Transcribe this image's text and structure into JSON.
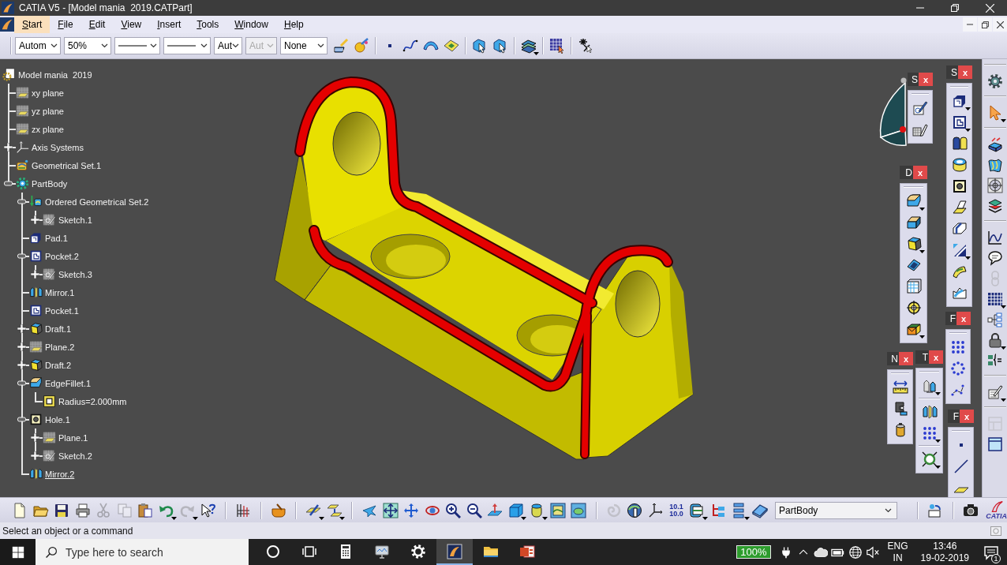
{
  "window": {
    "title": "CATIA V5 - [Model mania  2019.CATPart]"
  },
  "menu": [
    {
      "label": "Start",
      "selected": true
    },
    {
      "label": "File",
      "selected": false
    },
    {
      "label": "Edit",
      "selected": false
    },
    {
      "label": "View",
      "selected": false
    },
    {
      "label": "Insert",
      "selected": false
    },
    {
      "label": "Tools",
      "selected": false
    },
    {
      "label": "Window",
      "selected": false
    },
    {
      "label": "Help",
      "selected": false
    }
  ],
  "toolbar_selects": [
    {
      "kind": "text",
      "value": "Autom",
      "disabled": false
    },
    {
      "kind": "text",
      "value": "50%",
      "disabled": false
    },
    {
      "kind": "line",
      "disabled": false
    },
    {
      "kind": "line",
      "disabled": false
    },
    {
      "kind": "text",
      "value": "Aut",
      "disabled": false
    },
    {
      "kind": "text",
      "value": "Aut",
      "disabled": true
    },
    {
      "kind": "text",
      "value": "None",
      "disabled": false
    }
  ],
  "tree": {
    "label": "Model mania  2019",
    "kind": "part",
    "expandable": false,
    "in_work": false,
    "children": [
      {
        "label": "xy plane",
        "kind": "plane",
        "expandable": false,
        "in_work": false
      },
      {
        "label": "yz plane",
        "kind": "plane",
        "expandable": false,
        "in_work": false
      },
      {
        "label": "zx plane",
        "kind": "plane",
        "expandable": false,
        "in_work": false
      },
      {
        "label": "Axis Systems",
        "kind": "axis",
        "expandable": true,
        "expanded": false,
        "in_work": false
      },
      {
        "label": "Geometrical Set.1",
        "kind": "geoset",
        "expandable": false,
        "in_work": false
      },
      {
        "label": "PartBody",
        "kind": "body",
        "expandable": true,
        "expanded": true,
        "in_work": false,
        "children": [
          {
            "label": "Ordered Geometrical Set.2",
            "kind": "orderedset",
            "expandable": true,
            "expanded": true,
            "in_work": false,
            "children": [
              {
                "label": "Sketch.1",
                "kind": "sketch",
                "expandable": true,
                "expanded": false,
                "in_work": false
              }
            ]
          },
          {
            "label": "Pad.1",
            "kind": "pad",
            "expandable": false,
            "in_work": false
          },
          {
            "label": "Pocket.2",
            "kind": "pocket",
            "expandable": true,
            "expanded": true,
            "in_work": false,
            "children": [
              {
                "label": "Sketch.3",
                "kind": "sketch",
                "expandable": true,
                "expanded": false,
                "in_work": false
              }
            ]
          },
          {
            "label": "Mirror.1",
            "kind": "mirror",
            "expandable": false,
            "in_work": false
          },
          {
            "label": "Pocket.1",
            "kind": "pocket",
            "expandable": false,
            "in_work": false
          },
          {
            "label": "Draft.1",
            "kind": "draft",
            "expandable": true,
            "expanded": false,
            "in_work": false
          },
          {
            "label": "Plane.2",
            "kind": "plane",
            "expandable": true,
            "expanded": false,
            "in_work": false
          },
          {
            "label": "Draft.2",
            "kind": "draft",
            "expandable": true,
            "expanded": false,
            "in_work": false
          },
          {
            "label": "EdgeFillet.1",
            "kind": "fillet",
            "expandable": true,
            "expanded": true,
            "in_work": false,
            "children": [
              {
                "label": "Radius=2.000mm",
                "kind": "parameter",
                "expandable": false,
                "in_work": false
              }
            ]
          },
          {
            "label": "Hole.1",
            "kind": "hole",
            "expandable": true,
            "expanded": true,
            "in_work": false,
            "children": [
              {
                "label": "Plane.1",
                "kind": "plane",
                "expandable": true,
                "expanded": false,
                "in_work": false
              },
              {
                "label": "Sketch.2",
                "kind": "sketch",
                "expandable": true,
                "expanded": false,
                "in_work": false
              }
            ]
          },
          {
            "label": "Mirror.2",
            "kind": "mirror",
            "expandable": false,
            "in_work": true
          }
        ]
      }
    ]
  },
  "floating_toolbars": [
    {
      "kind": "features",
      "title": "S",
      "close": "x"
    },
    {
      "kind": "sketcher",
      "title": "S",
      "close": "x"
    },
    {
      "kind": "dressup",
      "title": "D",
      "close": "x"
    },
    {
      "kind": "pattern",
      "title": "F",
      "close": "x"
    },
    {
      "kind": "measure",
      "title": "N",
      "close": "x"
    },
    {
      "kind": "transform",
      "title": "T",
      "close": "x"
    },
    {
      "kind": "reference",
      "title": "F",
      "close": "x"
    }
  ],
  "right_dock": {
    "tool_groups": [
      [
        {
          "kind": "gear",
          "disabled": false
        }
      ],
      [
        {
          "kind": "pointer",
          "disabled": false
        }
      ],
      [
        {
          "kind": "cubearrows",
          "disabled": false
        },
        {
          "kind": "surface",
          "disabled": false
        },
        {
          "kind": "globecross",
          "disabled": false
        },
        {
          "kind": "layers",
          "disabled": false
        }
      ],
      [
        {
          "kind": "formula",
          "disabled": false
        },
        {
          "kind": "comment",
          "disabled": false
        },
        {
          "kind": "link",
          "disabled": true
        },
        {
          "kind": "table",
          "disabled": false
        },
        {
          "kind": "hierarchy",
          "disabled": false
        },
        {
          "kind": "lock",
          "disabled": false
        },
        {
          "kind": "equation",
          "disabled": false
        }
      ],
      [
        {
          "kind": "sketchanalysis",
          "disabled": false
        }
      ],
      [
        {
          "kind": "frame",
          "disabled": true
        },
        {
          "kind": "boxframe",
          "disabled": false
        }
      ]
    ]
  },
  "bottom_toolbar": {
    "left_groups": [
      [
        {
          "kind": "new",
          "disabled": false
        },
        {
          "kind": "open",
          "disabled": false
        },
        {
          "kind": "save",
          "disabled": false
        },
        {
          "kind": "print",
          "disabled": false
        },
        {
          "kind": "cut",
          "disabled": true
        },
        {
          "kind": "copy",
          "disabled": true
        },
        {
          "kind": "paste",
          "disabled": false
        },
        {
          "kind": "undo",
          "disabled": false
        },
        {
          "kind": "redo",
          "disabled": true
        },
        {
          "kind": "help",
          "disabled": false
        }
      ],
      [
        {
          "kind": "grid",
          "disabled": false
        }
      ],
      [
        {
          "kind": "catalog",
          "disabled": false
        }
      ],
      [
        {
          "kind": "sketchplane",
          "disabled": false
        },
        {
          "kind": "swapplane",
          "disabled": false
        }
      ],
      [
        {
          "kind": "fly",
          "disabled": false
        },
        {
          "kind": "fitall",
          "disabled": false
        },
        {
          "kind": "pan",
          "disabled": false
        },
        {
          "kind": "rotate",
          "disabled": false
        },
        {
          "kind": "zoomin",
          "disabled": false
        },
        {
          "kind": "zoomout",
          "disabled": false
        },
        {
          "kind": "normalview",
          "disabled": false
        },
        {
          "kind": "isoview",
          "disabled": false
        },
        {
          "kind": "shading",
          "disabled": false
        },
        {
          "kind": "hideshow",
          "disabled": false
        },
        {
          "kind": "swapspace",
          "disabled": false
        }
      ],
      [
        {
          "kind": "swirl",
          "disabled": true
        },
        {
          "kind": "handglobe",
          "disabled": false
        },
        {
          "kind": "axis",
          "disabled": false
        },
        {
          "kind": "precision",
          "disabled": false
        },
        {
          "kind": "multiview",
          "disabled": false
        },
        {
          "kind": "specs",
          "disabled": false
        },
        {
          "kind": "list",
          "disabled": false
        },
        {
          "kind": "book",
          "disabled": false
        }
      ]
    ],
    "precision_labels": [
      "10.1",
      "10.0"
    ],
    "current_body": "PartBody",
    "right_groups": [
      [
        {
          "kind": "swap",
          "disabled": false
        }
      ],
      [
        {
          "kind": "camera",
          "disabled": false
        }
      ]
    ]
  },
  "brand": {
    "name": "CATIA"
  },
  "status_bar": {
    "message": "Select an object or a command"
  },
  "taskbar": {
    "search": {
      "placeholder": "Type here to search"
    },
    "apps": [
      {
        "kind": "circle",
        "active": false
      },
      {
        "kind": "taskview",
        "active": false
      },
      {
        "kind": "calculator",
        "active": false
      },
      {
        "kind": "monitor",
        "active": false
      },
      {
        "kind": "gear",
        "active": false
      },
      {
        "kind": "cad",
        "active": true
      },
      {
        "kind": "folder",
        "active": false
      },
      {
        "kind": "slides",
        "active": false
      }
    ],
    "battery": "100%",
    "language": "ENG",
    "region": "IN",
    "time": "13:46",
    "date": "19-02-2019",
    "notifications": "1"
  }
}
